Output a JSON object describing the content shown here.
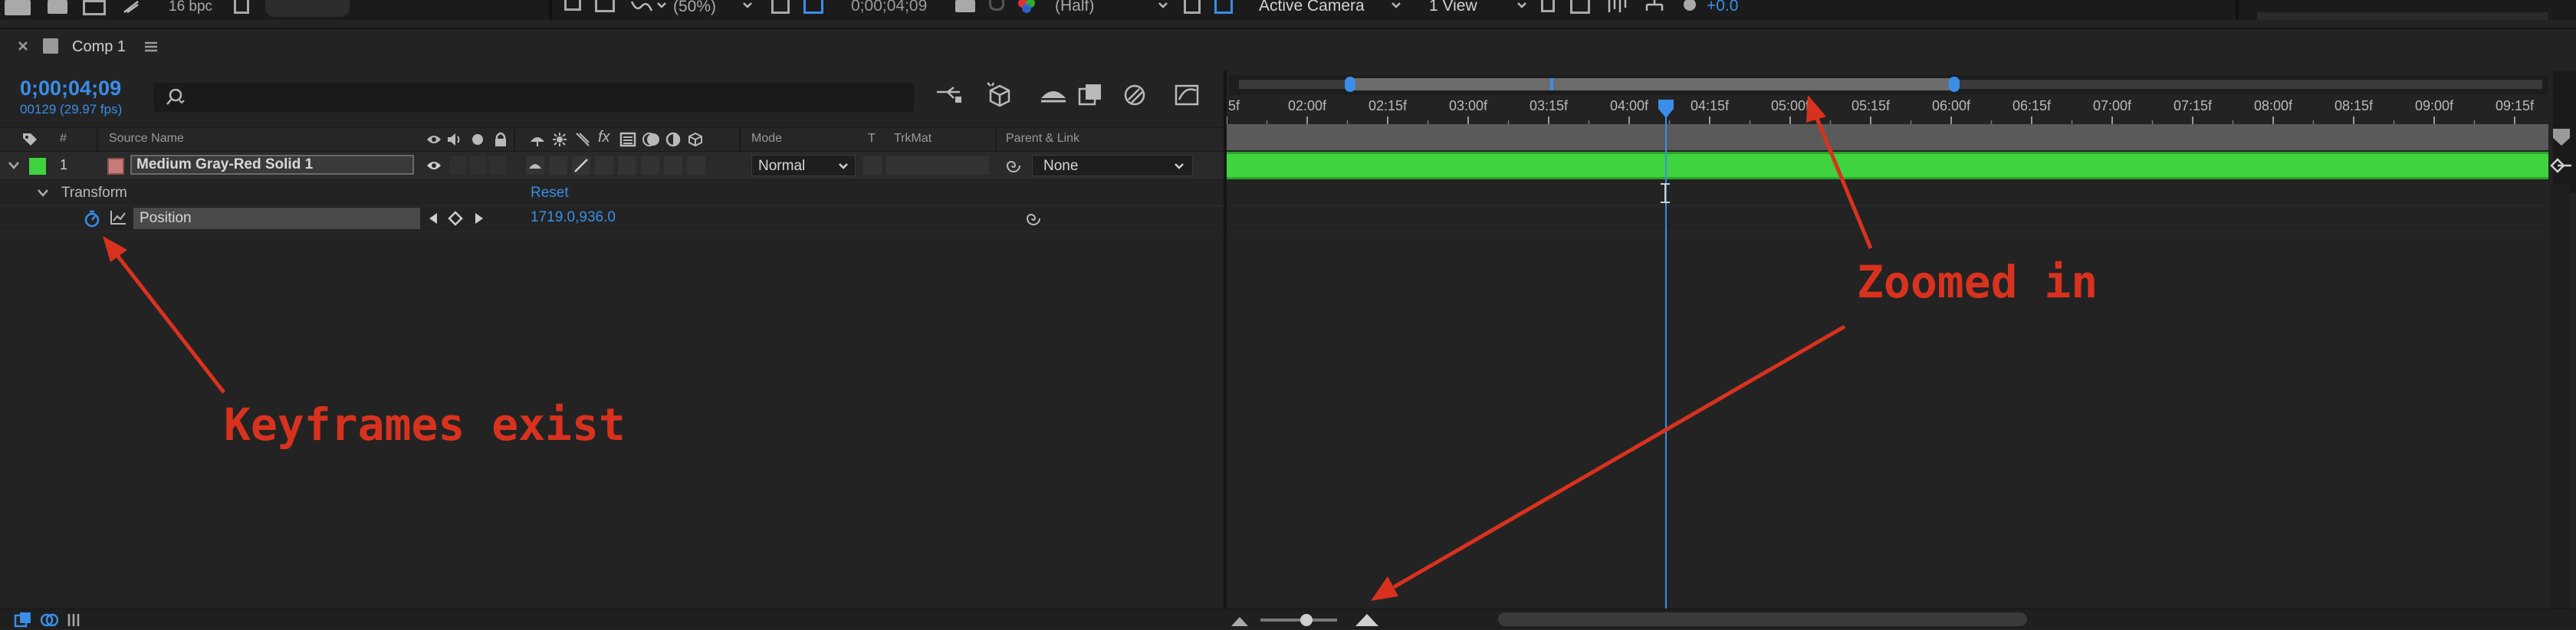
{
  "toolbar": {
    "bpc": "16 bpc",
    "magnification": "(50%)",
    "timecode": "0;00;04;09",
    "resolution": "(Half)",
    "camera": "Active Camera",
    "view": "1 View",
    "exposure": "+0.0"
  },
  "panel": {
    "tab_title": "Comp 1"
  },
  "timecode": {
    "value": "0;00;04;09",
    "frames": "00129 (29.97 fps)"
  },
  "columns": {
    "number": "#",
    "source_name": "Source Name",
    "mode": "Mode",
    "t": "T",
    "trkmat": "TrkMat",
    "parent": "Parent & Link"
  },
  "layer": {
    "number": "1",
    "name": "Medium Gray-Red Solid 1",
    "mode": "Normal",
    "parent": "None",
    "color": "#c87a7a",
    "label_color": "#3fd33f"
  },
  "transform": {
    "label": "Transform",
    "reset": "Reset",
    "property": "Position",
    "value": "1719.0,936.0"
  },
  "ruler": {
    "ticks": [
      "5f",
      "02:00f",
      "02:15f",
      "03:00f",
      "03:15f",
      "04:00f",
      "04:15f",
      "05:00f",
      "05:15f",
      "06:00f",
      "06:15f",
      "07:00f",
      "07:15f",
      "08:00f",
      "08:15f",
      "09:00f",
      "09:15f"
    ]
  },
  "annotations": {
    "keyframes": "Keyframes exist",
    "zoomed": "Zoomed in"
  },
  "colors": {
    "accent_blue": "#3a8ee8",
    "layer_bar": "#3fd33f",
    "annotation_red": "#d8321e"
  }
}
